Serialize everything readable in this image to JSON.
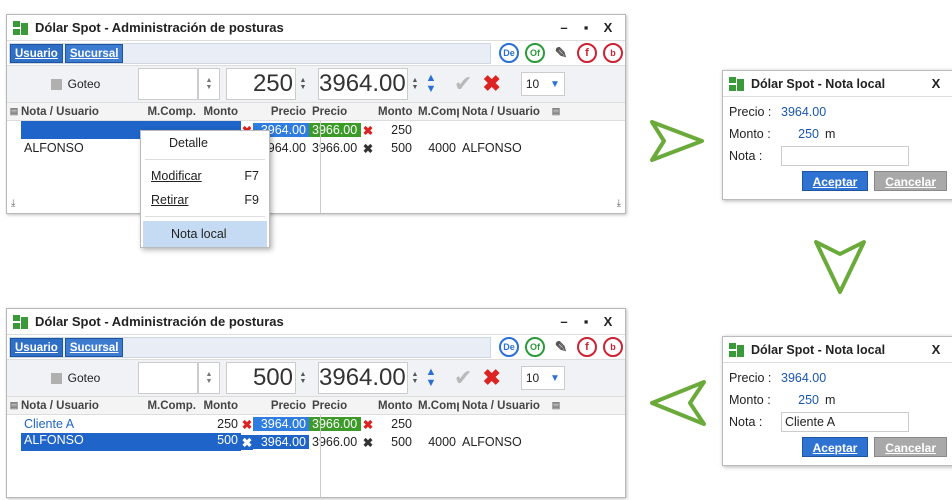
{
  "window": {
    "title": "Dólar Spot - Administración de posturas",
    "minimize": "–",
    "maximize": "▪",
    "close": "X",
    "tabs": [
      "Usuario",
      "Sucursal"
    ],
    "icon_labels": {
      "de": "De",
      "of": "Of",
      "f": "f",
      "b": "b"
    }
  },
  "controls": {
    "goteo_label": "Goteo",
    "qty": "10"
  },
  "columns": [
    "Nota / Usuario",
    "M.Comp.",
    "Monto",
    "Precio",
    "Precio",
    "Monto",
    "M.Comp.",
    "Nota / Usuario"
  ],
  "top": {
    "amount": "250",
    "price": "3964.00",
    "rows": [
      {
        "nota": "",
        "mcomp": "",
        "monto": "250",
        "precio_bid": "3964.00",
        "precio_ask": "3966.00",
        "monto2": "250",
        "mcomp2": "",
        "nota2": ""
      },
      {
        "nota": "ALFONSO",
        "mcomp": "",
        "monto": "",
        "precio_bid": "964.00",
        "precio_ask": "3966.00",
        "monto2": "500",
        "mcomp2": "4000",
        "nota2": "ALFONSO"
      }
    ],
    "menu": {
      "detalle": "Detalle",
      "modificar": "Modificar",
      "modificar_key": "F7",
      "retirar": "Retirar",
      "retirar_key": "F9",
      "nota_local": "Nota local"
    }
  },
  "bottom": {
    "amount": "500",
    "price": "3964.00",
    "rows": [
      {
        "nota": "Cliente A",
        "mcomp": "",
        "monto": "250",
        "precio_bid": "3964.00",
        "precio_ask": "3966.00",
        "monto2": "250",
        "mcomp2": "",
        "nota2": ""
      },
      {
        "nota": "ALFONSO",
        "mcomp": "",
        "monto": "500",
        "precio_bid": "3964.00",
        "precio_ask": "3966.00",
        "monto2": "500",
        "mcomp2": "4000",
        "nota2": "ALFONSO"
      }
    ]
  },
  "dialog1": {
    "title": "Dólar Spot - Nota local",
    "close": "X",
    "precio_label": "Precio :",
    "precio": "3964.00",
    "monto_label": "Monto :",
    "monto": "250",
    "unit": "m",
    "nota_label": "Nota :",
    "nota": "",
    "ok": "Aceptar",
    "cancel": "Cancelar"
  },
  "dialog2": {
    "title": "Dólar Spot - Nota local",
    "close": "X",
    "precio_label": "Precio :",
    "precio": "3964.00",
    "monto_label": "Monto :",
    "monto": "250",
    "unit": "m",
    "nota_label": "Nota :",
    "nota": "Cliente A",
    "ok": "Aceptar",
    "cancel": "Cancelar"
  },
  "colors": {
    "accent": "#2f73d2",
    "green_price": "#3b9a28",
    "arrow": "#6aaa3a"
  }
}
